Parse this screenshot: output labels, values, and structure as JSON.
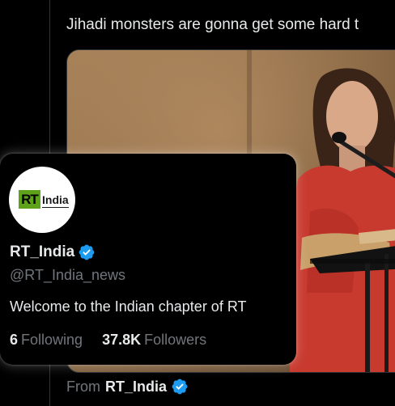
{
  "tweet": {
    "text": "Jihadi monsters are gonna get some hard t",
    "source_prefix": "From",
    "source_name": "RT_India"
  },
  "profile_card": {
    "avatar_logo": {
      "box_text": "RT",
      "suffix_text": "India"
    },
    "display_name": "RT_India",
    "handle": "@RT_India_news",
    "bio": "Welcome to the Indian chapter of RT",
    "following": {
      "count": "6",
      "label": "Following"
    },
    "followers": {
      "count": "37.8K",
      "label": "Followers"
    }
  },
  "colors": {
    "background": "#000000",
    "primary_text": "#e7e9ea",
    "secondary_text": "#71767b",
    "verified_badge": "#1d9bf0",
    "logo_green": "#5da21a"
  },
  "icons": {
    "verified": "verified-badge-icon"
  }
}
